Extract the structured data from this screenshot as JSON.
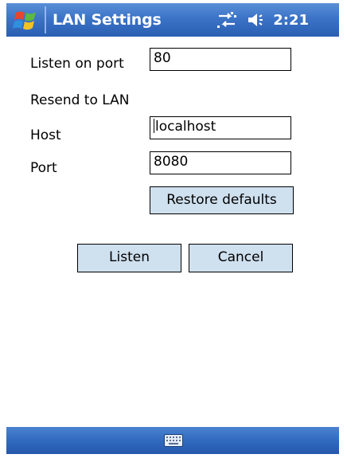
{
  "titlebar": {
    "title": "LAN Settings",
    "clock": "2:21",
    "icons": [
      "windows-start-icon",
      "connectivity-icon",
      "volume-icon"
    ]
  },
  "form": {
    "listen_port_label": "Listen on port",
    "listen_port_value": "80",
    "resend_label": "Resend to LAN",
    "host_label": "Host",
    "host_value": "localhost",
    "port_label": "Port",
    "port_value": "8080",
    "restore_label": "Restore defaults"
  },
  "actions": {
    "listen_label": "Listen",
    "cancel_label": "Cancel"
  },
  "bottombar": {
    "icon": "keyboard-icon"
  },
  "colors": {
    "titlebar": "#3b73c7",
    "button_bg": "#cfe0ef"
  }
}
